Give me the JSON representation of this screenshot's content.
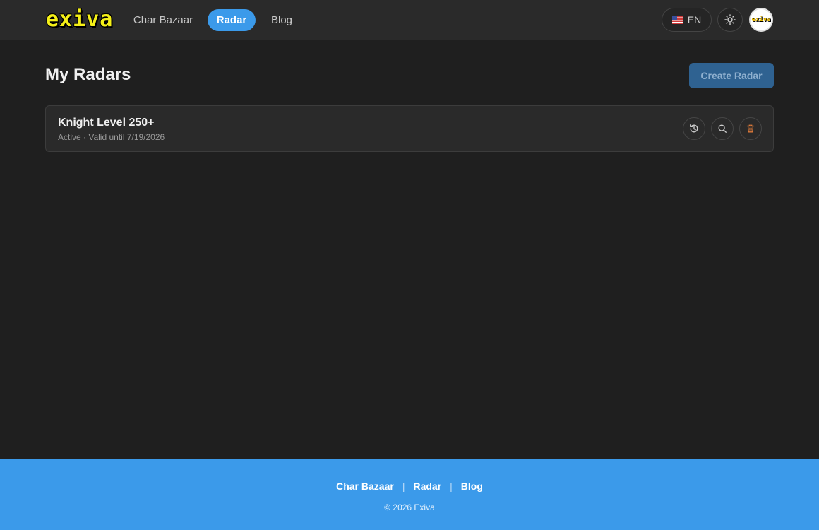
{
  "header": {
    "logo_text": "exiva",
    "nav": [
      {
        "label": "Char Bazaar",
        "active": false
      },
      {
        "label": "Radar",
        "active": true
      },
      {
        "label": "Blog",
        "active": false
      }
    ],
    "language": {
      "code": "EN",
      "flag_icon": "us-flag-icon"
    },
    "theme_icon": "sun-icon",
    "avatar_text": "exiva"
  },
  "main": {
    "title": "My Radars",
    "create_button": "Create Radar",
    "radars": [
      {
        "name": "Knight Level 250+",
        "status": "Active · Valid until 7/19/2026",
        "actions": [
          "history-icon",
          "search-icon",
          "trash-icon"
        ]
      }
    ]
  },
  "footer": {
    "links": [
      "Char Bazaar",
      "Radar",
      "Blog"
    ],
    "separator": "|",
    "copyright": "© 2026 Exiva"
  },
  "colors": {
    "background": "#1f1f1f",
    "header": "#2a2a2a",
    "accent": "#3b9aea",
    "logo": "#f5f018",
    "delete": "#e07b3a"
  }
}
